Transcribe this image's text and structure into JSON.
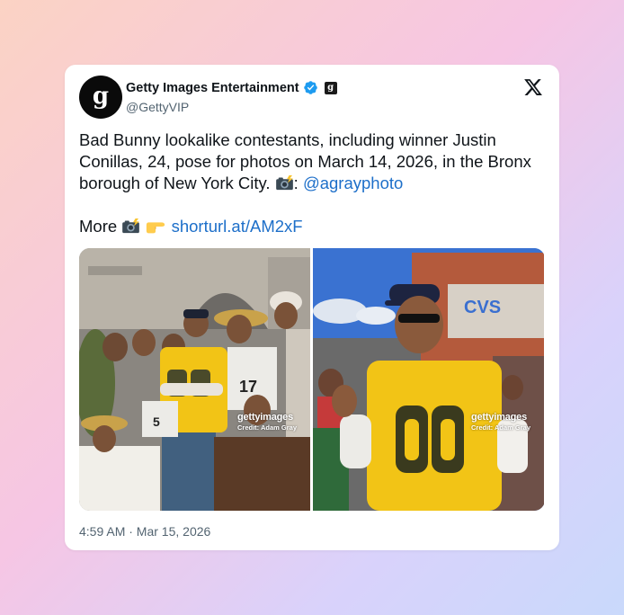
{
  "tweet": {
    "avatar_letter": "g",
    "display_name": "Getty Images Entertainment",
    "affiliation_letter": "g",
    "handle": "@GettyVIP",
    "text_part1": "Bad Bunny lookalike contestants, including winner Justin Conillas, 24, pose for photos on March 14, 2026, in the Bronx borough of New York City. ",
    "text_colon": ": ",
    "mention": "@agrayphoto",
    "more_label": "More ",
    "link": "shorturl.at/AM2xF",
    "timestamp": "4:59 AM · Mar 15, 2026"
  },
  "icons": {
    "verified": "verified-badge-icon",
    "affiliation": "getty-affiliation-icon",
    "platform": "x-logo-icon",
    "camera": "camera-flash-emoji",
    "pointing": "pointing-right-emoji"
  },
  "media": [
    {
      "watermark_brand": "gettyimages",
      "watermark_credit": "Credit: Adam Gray",
      "description": "group of lookalike contestants"
    },
    {
      "watermark_brand": "gettyimages",
      "watermark_credit": "Credit: Adam Gray",
      "description": "winner in yellow 00 jersey"
    }
  ],
  "colors": {
    "link": "#1d6fc9",
    "verified": "#1d9bf0",
    "text": "#0f1419",
    "muted": "#536471"
  }
}
